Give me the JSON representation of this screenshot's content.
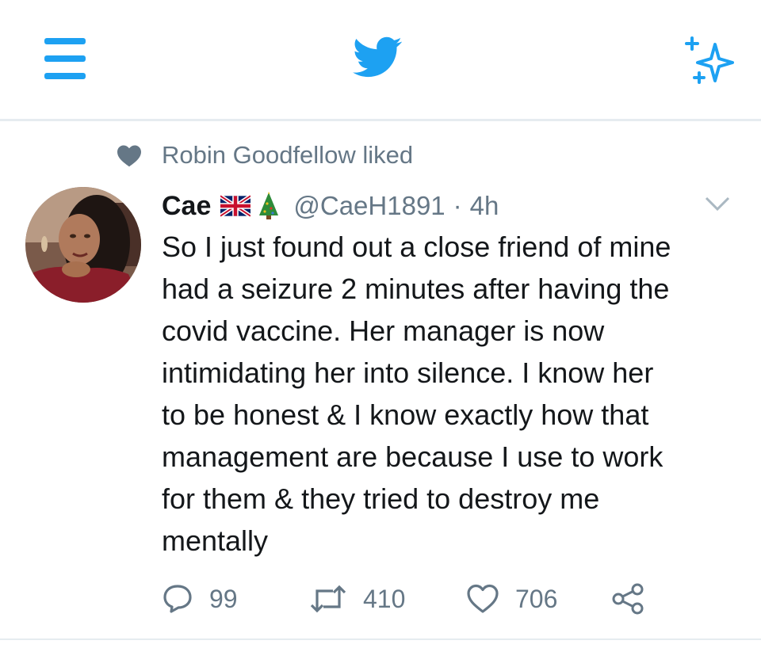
{
  "header": {
    "menu_icon": "hamburger-menu-icon",
    "logo_icon": "twitter-bird-icon",
    "sparkle_icon": "sparkle-icon",
    "accent_color": "#1da1f2"
  },
  "social_context": {
    "icon": "heart-filled-icon",
    "text": "Robin Goodfellow liked"
  },
  "tweet": {
    "author": {
      "display_name": "Cae",
      "name_emojis": [
        "uk-flag-icon",
        "christmas-tree-icon"
      ],
      "handle": "@CaeH1891"
    },
    "separator": "·",
    "time": "4h",
    "text": "So I just found out a close friend of mine\nhad a seizure 2 minutes after having the\ncovid vaccine. Her manager is now\nintimidating her into silence. I know her\nto be honest & I know exactly how that\nmanagement are because I use to work\nfor them & they tried to destroy me\nmentally",
    "actions": {
      "reply": {
        "icon": "reply-icon",
        "count": "99"
      },
      "retweet": {
        "icon": "retweet-icon",
        "count": "410"
      },
      "like": {
        "icon": "heart-outline-icon",
        "count": "706"
      },
      "share": {
        "icon": "share-icon"
      }
    }
  },
  "colors": {
    "text_primary": "#14171a",
    "text_secondary": "#657786",
    "separator": "#e6ecf0"
  }
}
